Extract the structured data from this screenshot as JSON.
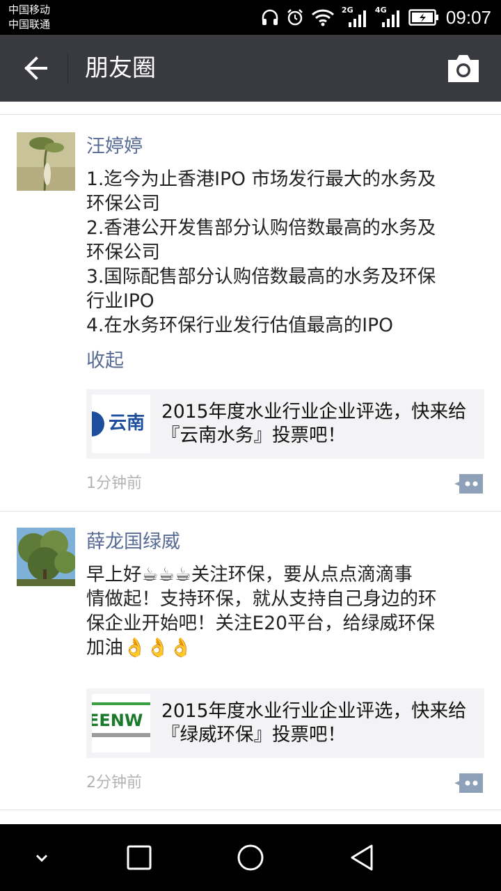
{
  "status_bar": {
    "carrier_1": "中国移动",
    "carrier_2": "中国联通",
    "net_1": "2G",
    "net_2": "4G",
    "time": "09:07"
  },
  "header": {
    "title": "朋友圈",
    "back_icon": "arrow-left-icon",
    "camera_icon": "camera-icon"
  },
  "posts": [
    {
      "author": "汪婷婷",
      "content_lines": [
        "1.迄今为止香港IPO 市场发行最大的水务及",
        "环保公司",
        "2.香港公开发售部分认购倍数最高的水务及",
        "环保公司",
        "3.国际配售部分认购倍数最高的水务及环保",
        "行业IPO",
        "4.在水务环保行业发行估值最高的IPO"
      ],
      "collapse_label": "收起",
      "share": {
        "thumb_text": "云南",
        "text_lines": [
          "2015年度水业行业企业评选，快来给",
          "『云南水务』投票吧！"
        ]
      },
      "time": "1分钟前"
    },
    {
      "author": "薛龙国绿威",
      "content_lines": [
        "早上好☕☕☕关注环保，要从点点滴滴事",
        "情做起！支持环保，就从支持自己身边的环",
        "保企业开始吧！关注E20平台，给绿威环保",
        "加油👌👌👌"
      ],
      "share": {
        "thumb_text": "EENW",
        "text_lines": [
          "2015年度水业行业企业评选，快来给",
          "『绿威环保』投票吧！"
        ]
      },
      "time": "2分钟前"
    }
  ],
  "colors": {
    "titlebar": "#393a3f",
    "link": "#576b95",
    "timestamp": "#b2b2b2",
    "share_bg": "#f3f3f5"
  }
}
